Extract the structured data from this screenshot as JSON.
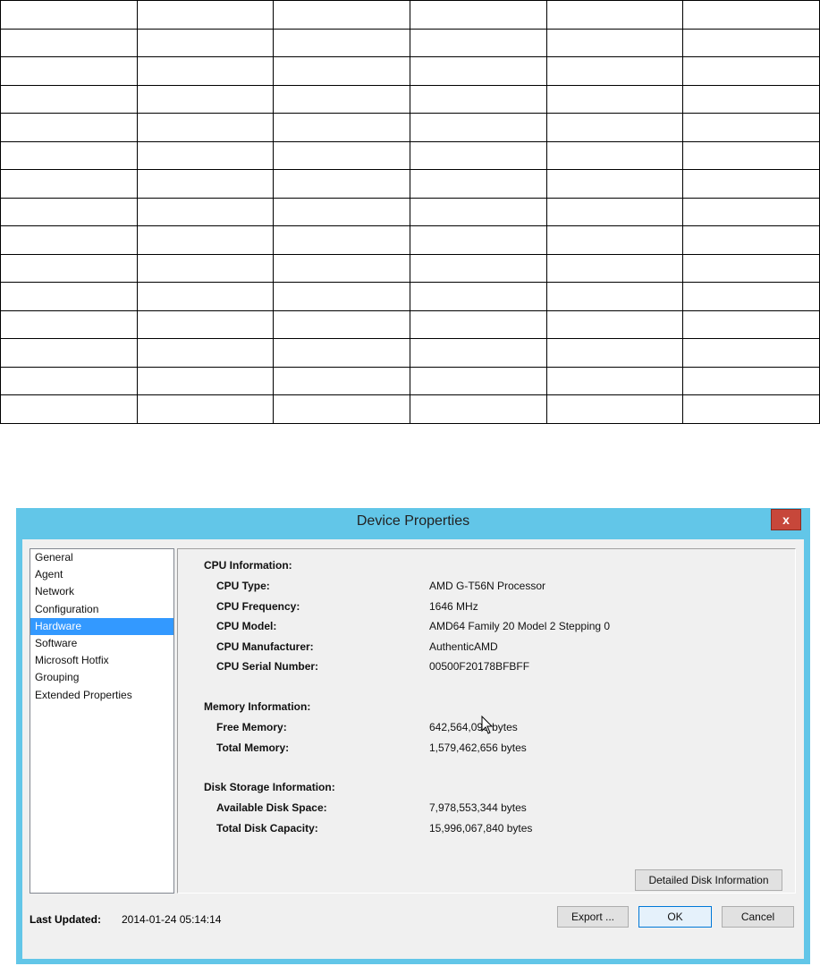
{
  "grid": {
    "rows": 15,
    "cols": 6
  },
  "dialog": {
    "title": "Device Properties",
    "close_label": "x",
    "nav": [
      "General",
      "Agent",
      "Network",
      "Configuration",
      "Hardware",
      "Software",
      "Microsoft Hotfix",
      "Grouping",
      "Extended Properties"
    ],
    "selected_nav": "Hardware",
    "cpu": {
      "heading": "CPU Information:",
      "rows": [
        {
          "label": "CPU Type:",
          "value": "AMD G-T56N Processor"
        },
        {
          "label": "CPU Frequency:",
          "value": "1646 MHz"
        },
        {
          "label": "CPU Model:",
          "value": "AMD64 Family 20 Model 2 Stepping 0"
        },
        {
          "label": "CPU Manufacturer:",
          "value": "AuthenticAMD"
        },
        {
          "label": "CPU Serial Number:",
          "value": "00500F20178BFBFF"
        }
      ]
    },
    "memory": {
      "heading": "Memory Information:",
      "rows": [
        {
          "label": "Free Memory:",
          "value": "642,564,096 bytes"
        },
        {
          "label": "Total Memory:",
          "value": "1,579,462,656 bytes"
        }
      ]
    },
    "disk": {
      "heading": "Disk Storage Information:",
      "rows": [
        {
          "label": "Available Disk Space:",
          "value": "7,978,553,344 bytes"
        },
        {
          "label": "Total Disk Capacity:",
          "value": "15,996,067,840 bytes"
        }
      ]
    },
    "detailed_disk_button": "Detailed Disk Information",
    "last_updated_label": "Last Updated:",
    "last_updated_value": "2014-01-24 05:14:14",
    "export_button": "Export ...",
    "ok_button": "OK",
    "cancel_button": "Cancel"
  }
}
